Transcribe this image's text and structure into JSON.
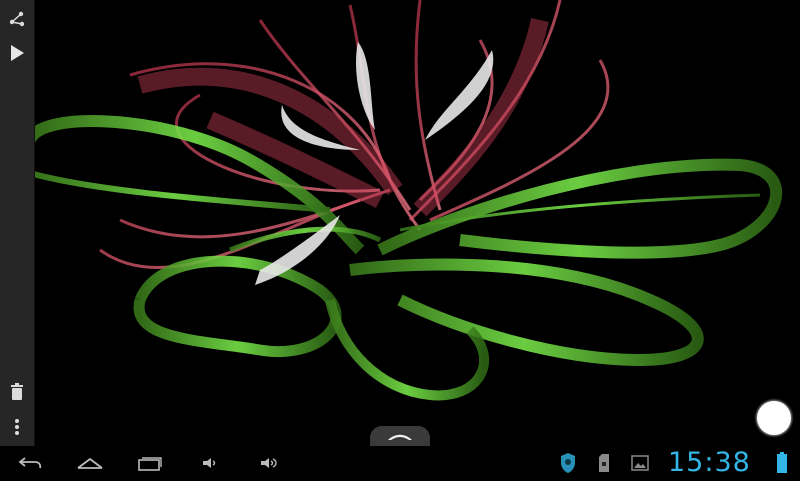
{
  "app": {
    "toolbar": {
      "share_icon": "share-icon",
      "play_icon": "play-icon",
      "trash_icon": "trash-icon",
      "more_icon": "overflow-menu-icon"
    },
    "fab_icon": "circle-button"
  },
  "system_bar": {
    "nav": [
      "back-icon",
      "home-icon",
      "recent-apps-icon",
      "volume-down-icon",
      "volume-up-icon"
    ],
    "status_icons": [
      "shield-icon",
      "sd-card-icon",
      "image-icon"
    ],
    "time": "15:38",
    "battery_icon": "battery-icon"
  },
  "colors": {
    "accent_clock": "#33b5e5",
    "petal_red": "#d84a5e",
    "petal_green": "#76e04a",
    "background": "#000000"
  }
}
